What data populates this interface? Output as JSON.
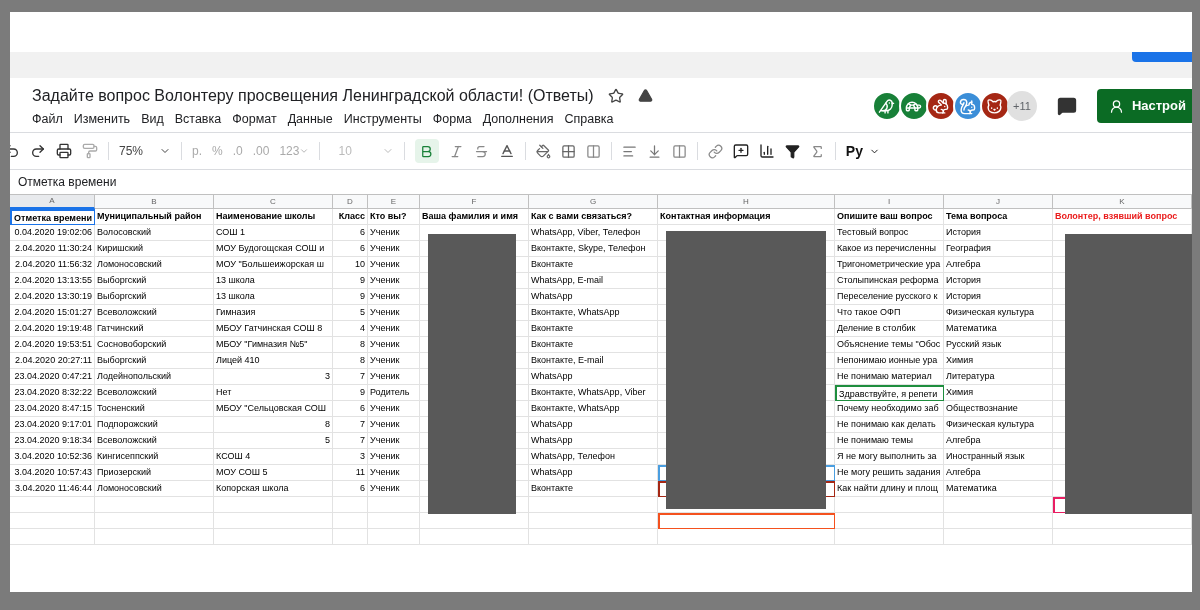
{
  "document": {
    "title": "Задайте вопрос Волонтеру просвещения Ленинградской области! (Ответы)",
    "starred": false
  },
  "collaborators": [
    {
      "color": "#188038",
      "kind": "bird"
    },
    {
      "color": "#188038",
      "kind": "turtle"
    },
    {
      "color": "#a52714",
      "kind": "rabbit"
    },
    {
      "color": "#3b8ed8",
      "kind": "squirrel"
    },
    {
      "color": "#a52714",
      "kind": "cat"
    }
  ],
  "collaborators_more": "+11",
  "share_button": "Настрой",
  "menu": [
    "Файл",
    "Изменить",
    "Вид",
    "Вставка",
    "Формат",
    "Данные",
    "Инструменты",
    "Форма",
    "Дополнения",
    "Справка"
  ],
  "toolbar": {
    "zoom": "75%",
    "currency": "р.",
    "percent": "%",
    "decrease_decimals": ".0",
    "increase_decimals": ".00",
    "number_format": "123",
    "font_size": "10",
    "input_tools": "Ру",
    "bold_selected": true
  },
  "formula_bar": "Отметка времени",
  "columns": [
    {
      "letter": "A",
      "heading": "Отметка времени",
      "selected": true
    },
    {
      "letter": "B",
      "heading": "Муниципальный район",
      "selected": false
    },
    {
      "letter": "C",
      "heading": "Наименование школы",
      "selected": false
    },
    {
      "letter": "D",
      "heading": "Класс",
      "selected": false
    },
    {
      "letter": "E",
      "heading": "Кто вы?",
      "selected": false
    },
    {
      "letter": "F",
      "heading": "Ваша фамилия и имя",
      "selected": false
    },
    {
      "letter": "G",
      "heading": "Как с вами связаться?",
      "selected": false
    },
    {
      "letter": "H",
      "heading": "Контактная информация",
      "selected": false
    },
    {
      "letter": "I",
      "heading": "Опишите ваш вопрос",
      "selected": false
    },
    {
      "letter": "J",
      "heading": "Тема вопроса",
      "selected": false
    },
    {
      "letter": "K",
      "heading": "Волонтер, взявший вопрос",
      "selected": false,
      "color": "#ea1c1c"
    }
  ],
  "rows": [
    {
      "cells": {
        "A": "0.04.2020 19:02:06",
        "B": "Волосовский",
        "C": "СОШ 1",
        "D": "6",
        "E": "Ученик",
        "G": "WhatsApp, Viber, Телефон",
        "I": "Тестовый вопрос",
        "J": "История"
      }
    },
    {
      "cells": {
        "A": "2.04.2020 11:30:24",
        "B": "Киришский",
        "C": "МОУ Будогощская СОШ и",
        "D": "6",
        "E": "Ученик",
        "G": "Вконтакте, Skype, Телефон",
        "I": "Какое из перечисленны",
        "J": "География"
      }
    },
    {
      "cells": {
        "A": "2.04.2020 11:56:32",
        "B": "Ломоносовский",
        "C": "МОУ \"Большеижорская ш",
        "D": "10",
        "E": "Ученик",
        "G": "Вконтакте",
        "I": "Тригонометрические ура",
        "J": "Алгебра"
      }
    },
    {
      "cells": {
        "A": "2.04.2020 13:13:55",
        "B": "Выборгский",
        "C": "13 школа",
        "D": "9",
        "E": "Ученик",
        "G": "WhatsApp, E-mail",
        "I": "Столыпинская реформа",
        "J": "История"
      }
    },
    {
      "cells": {
        "A": "2.04.2020 13:30:19",
        "B": "Выборгский",
        "C": "13 школа",
        "D": "9",
        "E": "Ученик",
        "G": "WhatsApp",
        "I": "Переселение русского к",
        "J": "История"
      }
    },
    {
      "cells": {
        "A": "2.04.2020 15:01:27",
        "B": "Всеволожский",
        "C": "Гимназия",
        "D": "5",
        "E": "Ученик",
        "G": "Вконтакте, WhatsApp",
        "I": "Что такое ОФП",
        "J": "Физическая культура"
      }
    },
    {
      "cells": {
        "A": "2.04.2020 19:19:48",
        "B": "Гатчинский",
        "C": "МБОУ Гатчинская СОШ 8",
        "D": "4",
        "E": "Ученик",
        "G": "Вконтакте",
        "I": "Деление в столбик",
        "J": "Математика"
      }
    },
    {
      "cells": {
        "A": "2.04.2020 19:53:51",
        "B": "Сосновоборский",
        "C": "МБОУ \"Гимназия №5\"",
        "D": "8",
        "E": "Ученик",
        "G": "Вконтакте",
        "I": "Объяснение темы \"Обос",
        "J": "Русский язык"
      }
    },
    {
      "cells": {
        "A": "2.04.2020 20:27:11",
        "B": "Выборгский",
        "C": "Лицей 410",
        "D": "8",
        "E": "Ученик",
        "G": "Вконтакте, E-mail",
        "I": "Непонимаю ионные ура",
        "J": "Химия"
      }
    },
    {
      "cells": {
        "A": "23.04.2020 0:47:21",
        "B": "Лодейнопольский",
        "C": "3",
        "D": "7",
        "E": "Ученик",
        "G": "WhatsApp",
        "I": "Не понимаю материал",
        "J": "Литература"
      }
    },
    {
      "cursors": {
        "I": {
          "color": "#1e8e3e"
        }
      },
      "cells": {
        "A": "23.04.2020 8:32:22",
        "B": "Всеволожский",
        "C": "Нет",
        "D": "9",
        "E": "Родитель",
        "G": "Вконтакте, WhatsApp, Viber",
        "I": "Здравствуйте,  я репети",
        "J": "Химия"
      }
    },
    {
      "cells": {
        "A": "23.04.2020 8:47:15",
        "B": "Тосненский",
        "C": "МБОУ \"Сельцовская СОШ",
        "D": "6",
        "E": "Ученик",
        "G": "Вконтакте, WhatsApp",
        "I": "Почему необходимо заб",
        "J": "Обществознание"
      }
    },
    {
      "cells": {
        "A": "23.04.2020 9:17:01",
        "B": "Подпорожский",
        "C": "8",
        "D": "7",
        "E": "Ученик",
        "G": "WhatsApp",
        "I": "Не понимаю как делать",
        "J": "Физическая культура"
      }
    },
    {
      "cells": {
        "A": "23.04.2020 9:18:34",
        "B": "Всеволожский",
        "C": "5",
        "D": "7",
        "E": "Ученик",
        "G": "WhatsApp",
        "I": "Не понимаю темы",
        "J": "Алгебра"
      }
    },
    {
      "cells": {
        "A": "3.04.2020 10:52:36",
        "B": "Кингисеппский",
        "C": "КСОШ 4",
        "D": "3",
        "E": "Ученик",
        "G": "WhatsApp, Телефон",
        "I": "Я не могу выполнить за",
        "J": "Иностранный язык"
      }
    },
    {
      "cursors": {
        "H": {
          "color": "#4a9ee0"
        }
      },
      "cells": {
        "A": "3.04.2020 10:57:43",
        "B": "Приозерский",
        "C": "МОУ СОШ 5",
        "D": "11",
        "E": "Ученик",
        "G": "WhatsApp",
        "I": "Не могу решить задания",
        "J": "Алгебра"
      }
    },
    {
      "cursors": {
        "H": {
          "color": "#a52714"
        }
      },
      "cells": {
        "A": "3.04.2020 11:46:44",
        "B": "Ломоносовский",
        "C": "Копорская школа",
        "D": "6",
        "E": "Ученик",
        "G": "Вконтакте",
        "I": "Как найти длину и площ",
        "J": "Математика"
      }
    },
    {
      "cursors": {
        "K": {
          "color": "#e91e63"
        }
      }
    },
    {
      "cursors": {
        "H": {
          "color": "#f4511e"
        }
      }
    },
    {}
  ]
}
